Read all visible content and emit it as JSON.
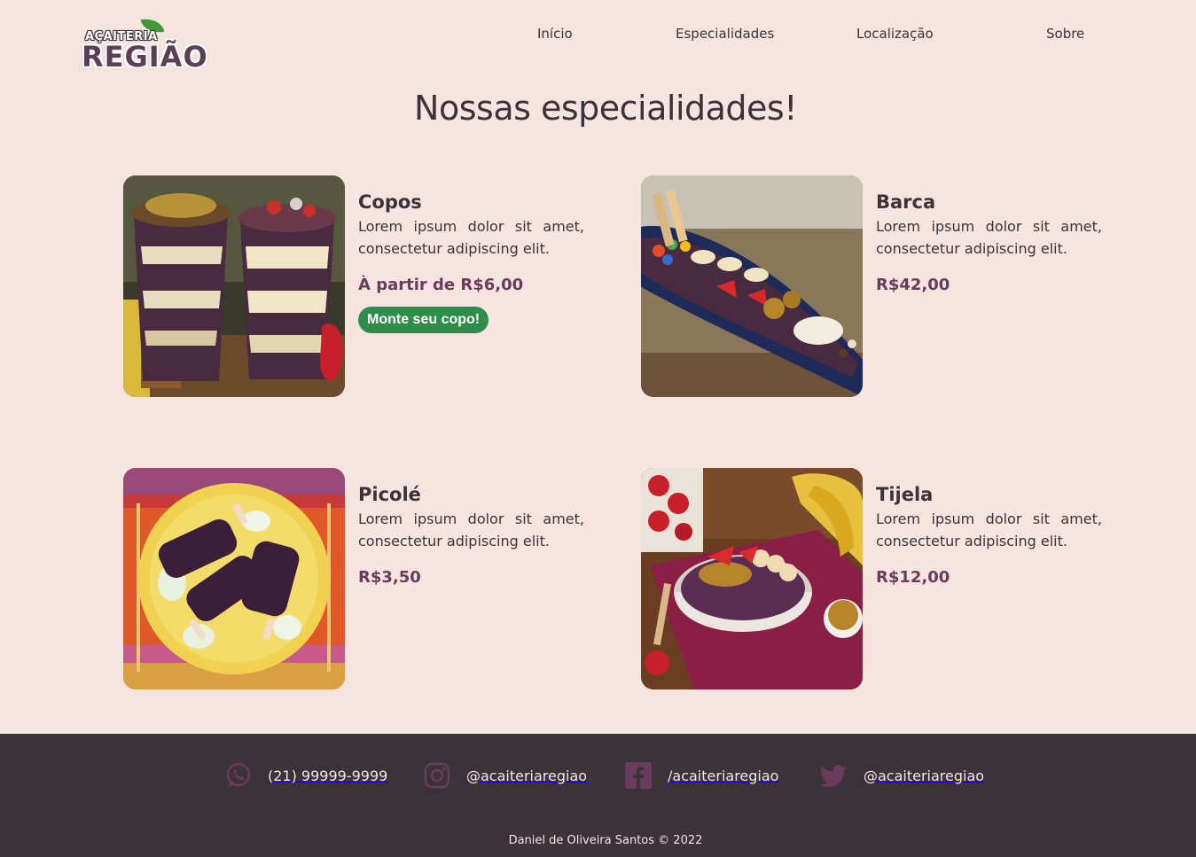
{
  "brand": {
    "logo_top": "AÇAITERIA",
    "logo_main": "REGIÃO"
  },
  "nav": {
    "items": [
      {
        "label": "Início"
      },
      {
        "label": "Especialidades"
      },
      {
        "label": "Localização"
      },
      {
        "label": "Sobre"
      }
    ]
  },
  "page": {
    "title": "Nossas especialidades!"
  },
  "products": [
    {
      "name": "Copos",
      "description": "Lorem ipsum dolor sit amet, consectetur adipiscing elit.",
      "price": "À partir de R$6,00",
      "button": "Monte seu copo!",
      "image": "acai-cups-photo"
    },
    {
      "name": "Barca",
      "description": "Lorem ipsum dolor sit amet, consectetur adipiscing elit.",
      "price": "R$42,00",
      "image": "acai-boat-photo"
    },
    {
      "name": "Picolé",
      "description": "Lorem ipsum dolor sit amet, consectetur adipiscing elit.",
      "price": "R$3,50",
      "image": "acai-popsicles-photo"
    },
    {
      "name": "Tijela",
      "description": "Lorem ipsum dolor sit amet, consectetur adipiscing elit.",
      "price": "R$12,00",
      "image": "acai-bowl-photo"
    }
  ],
  "footer": {
    "contacts": [
      {
        "icon": "whatsapp-icon",
        "text": "(21) 99999-9999"
      },
      {
        "icon": "instagram-icon",
        "text": "@acaiteriaregiao"
      },
      {
        "icon": "facebook-icon",
        "text": "/acaiteriaregiao"
      },
      {
        "icon": "twitter-icon",
        "text": "@acaiteriaregiao"
      }
    ],
    "credit": "Daniel de Oliveira Santos © 2022"
  },
  "colors": {
    "background": "#f5e4e0",
    "text": "#3b3339",
    "price": "#6a3b5a",
    "button": "#2f8c4a",
    "footer": "#3b3339",
    "icon": "#6a3b5a"
  }
}
